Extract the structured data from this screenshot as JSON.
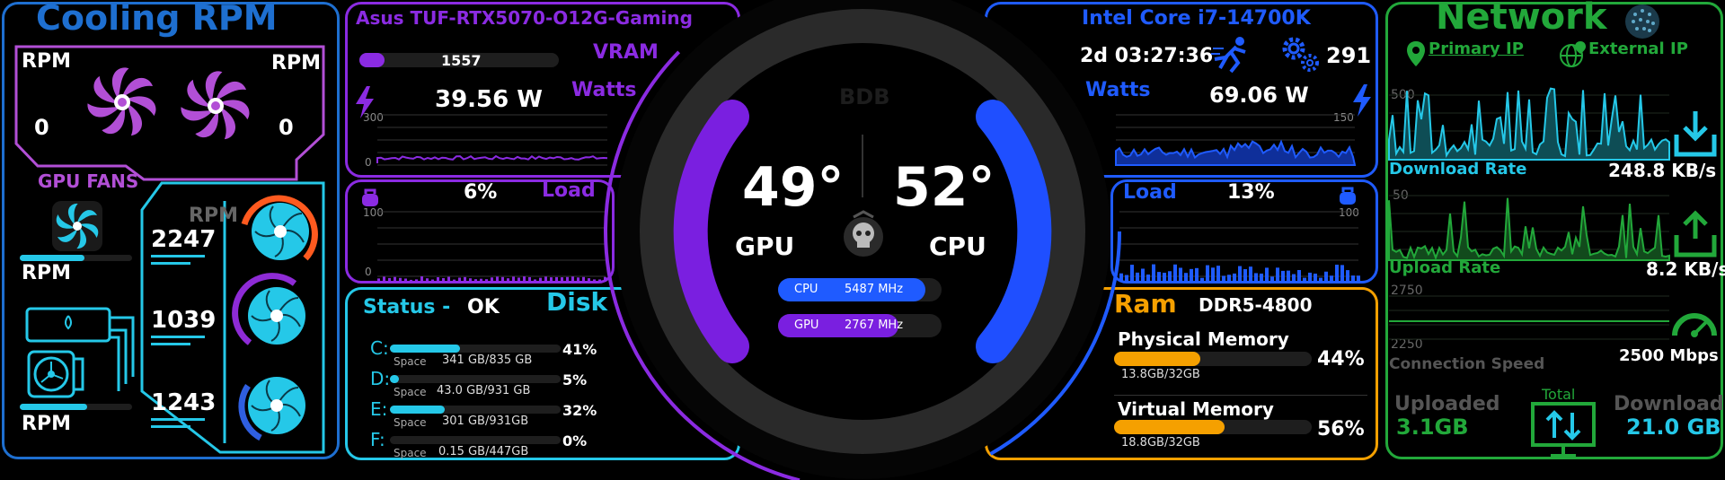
{
  "cooling": {
    "title": "Cooling RPM",
    "gpu_fans": {
      "label": "GPU FANS",
      "rpm_label_left": "RPM",
      "rpm_label_right": "RPM",
      "fan1_value": "0",
      "fan2_value": "0"
    },
    "cpu_fan": {
      "label": "RPM"
    },
    "pump": {
      "label": "RPM"
    },
    "case_label": "RPM",
    "case_fans": [
      "2247",
      "1039",
      "1243"
    ],
    "colors": {
      "title": "#1e6fd0",
      "gpu": "#b24fd6",
      "case": "#25c8e8"
    }
  },
  "gpu": {
    "name": "Asus TUF-RTX5070-O12G-Gaming",
    "vram_label": "VRAM",
    "vram_value": "1557",
    "watts_label": "Watts",
    "watts_value": "39.56 W",
    "power_axis_max": "300",
    "power_axis_min": "0",
    "load_label": "Load",
    "load_value": "6%",
    "load_axis_max": "100",
    "load_axis_min": "0",
    "color": "#8b2be2"
  },
  "center": {
    "brand": "BDB",
    "gpu_temp": "49°",
    "gpu_label": "GPU",
    "cpu_temp": "52°",
    "cpu_label": "CPU",
    "cpu_clock_label": "CPU",
    "cpu_clock_value": "5487 MHz",
    "gpu_clock_label": "GPU",
    "gpu_clock_value": "2767 MHz",
    "gpu_gauge_fraction": 0.49,
    "cpu_gauge_fraction": 0.52
  },
  "cpu": {
    "name": "Intel Core i7-14700K",
    "uptime": "2d 03:27:36",
    "process_count": "291",
    "watts_label": "Watts",
    "watts_value": "69.06 W",
    "power_axis_max": "150",
    "power_axis_min": "0",
    "load_label": "Load",
    "load_value": "13%",
    "load_axis_max": "100",
    "color": "#1f5bff"
  },
  "disk": {
    "status_label": "Status -",
    "status_value": "OK",
    "title": "Disk",
    "space_label": "Space",
    "drives": [
      {
        "letter": "C:",
        "usage": "341 GB/835 GB",
        "percent": "41%",
        "fraction": 0.41
      },
      {
        "letter": "D:",
        "usage": "43.0 GB/931 GB",
        "percent": "5%",
        "fraction": 0.05
      },
      {
        "letter": "E:",
        "usage": "301 GB/931GB",
        "percent": "32%",
        "fraction": 0.32
      },
      {
        "letter": "F:",
        "usage": "0.15 GB/447GB",
        "percent": "0%",
        "fraction": 0.0
      }
    ],
    "color": "#25c8e8"
  },
  "ram": {
    "title": "Ram",
    "type": "DDR5-4800",
    "physical_label": "Physical Memory",
    "physical_usage": "13.8GB/32GB",
    "physical_percent": "44%",
    "physical_fraction": 0.44,
    "virtual_label": "Virtual Memory",
    "virtual_usage": "18.8GB/32GB",
    "virtual_percent": "56%",
    "virtual_fraction": 0.56,
    "color": "#f5a000"
  },
  "network": {
    "title": "Network",
    "primary_ip_label": "Primary IP",
    "external_ip_label": "External IP",
    "download_axis_max": "500",
    "download_label": "Download Rate",
    "download_value": "248.8 KB/s",
    "upload_axis_max": "50",
    "upload_label": "Upload Rate",
    "upload_value": "8.2 KB/s",
    "speed_axis_max": "2750",
    "speed_axis_min": "2250",
    "speed_label": "Connection Speed",
    "speed_value": "2500 Mbps",
    "uploaded_label": "Uploaded",
    "uploaded_value": "3.1GB",
    "total_label": "Total",
    "downloaded_label": "Download",
    "downloaded_value": "21.0 GB",
    "colors": {
      "accent": "#22a83a",
      "download": "#25c8e8"
    }
  }
}
